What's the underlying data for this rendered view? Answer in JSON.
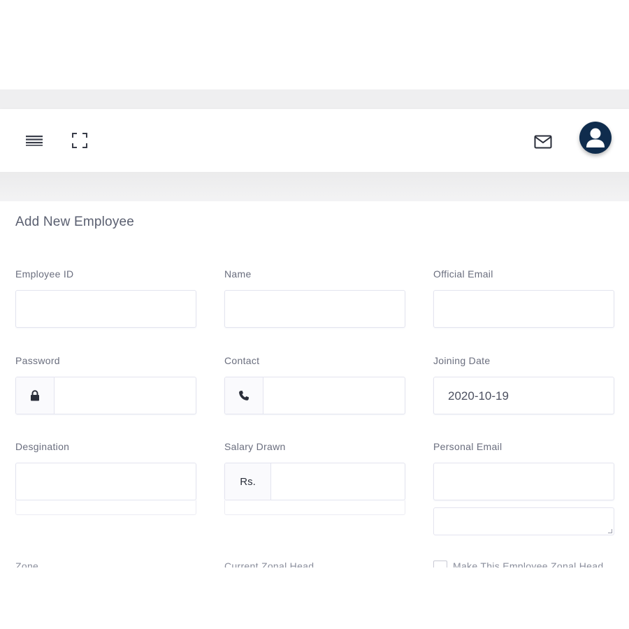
{
  "header": {
    "menu_icon": "hamburger-menu-icon",
    "expand_icon": "fullscreen-expand-icon",
    "mail_icon": "envelope-icon",
    "avatar_icon": "user-avatar-icon",
    "avatar_color": "#0f2c4d"
  },
  "page": {
    "title": "Add New Employee"
  },
  "form": {
    "employee_id": {
      "label": "Employee ID",
      "value": ""
    },
    "name": {
      "label": "Name",
      "value": ""
    },
    "official_email": {
      "label": "Official Email",
      "value": ""
    },
    "password": {
      "label": "Password",
      "value": "",
      "icon": "lock-icon"
    },
    "contact": {
      "label": "Contact",
      "value": "",
      "icon": "phone-icon"
    },
    "joining_date": {
      "label": "Joining Date",
      "value": "2020-10-19"
    },
    "designation": {
      "label": "Desgination",
      "value": ""
    },
    "salary_drawn": {
      "label": "Salary Drawn",
      "prefix": "Rs.",
      "value": ""
    },
    "personal_email": {
      "label": "Personal Email",
      "value": ""
    },
    "zone": {
      "label": "Zone"
    },
    "current_zonal_head": {
      "label": "Current Zonal Head"
    },
    "make_zonal_head": {
      "label": "Make This Employee Zonal Head",
      "checked": false
    }
  }
}
